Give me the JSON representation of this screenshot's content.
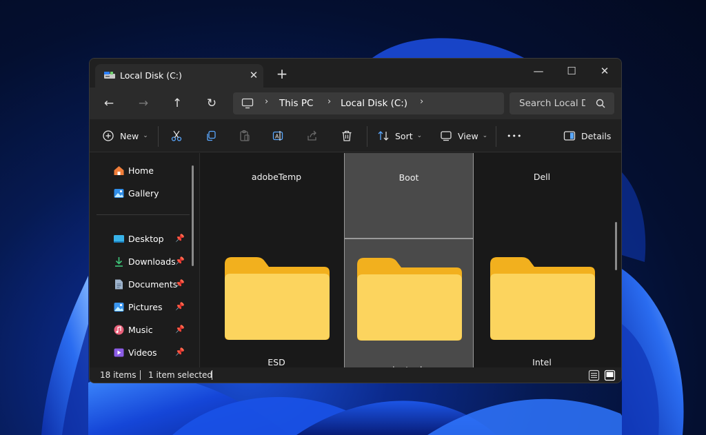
{
  "window": {
    "tab_title": "Local Disk (C:)",
    "tab_close": "✕",
    "new_tab": "+",
    "minimize": "—",
    "maximize": "☐",
    "close": "✕"
  },
  "nav": {
    "back": "←",
    "forward": "→",
    "up": "↑",
    "refresh": "↻",
    "breadcrumb": [
      "This PC",
      "Local Disk (C:)"
    ],
    "separator": "›",
    "search_placeholder": "Search Local Disk (C:)"
  },
  "toolbar": {
    "new_label": "New",
    "sort_label": "Sort",
    "view_label": "View",
    "more_label": "•••",
    "details_label": "Details",
    "caret": "⌄"
  },
  "sidebar": {
    "top": [
      {
        "label": "Home",
        "icon": "home-icon"
      },
      {
        "label": "Gallery",
        "icon": "gallery-icon"
      }
    ],
    "quick_access": [
      {
        "label": "Desktop",
        "icon": "desktop-icon",
        "pinned": true
      },
      {
        "label": "Downloads",
        "icon": "downloads-icon",
        "pinned": true
      },
      {
        "label": "Documents",
        "icon": "documents-icon",
        "pinned": true
      },
      {
        "label": "Pictures",
        "icon": "pictures-icon",
        "pinned": true
      },
      {
        "label": "Music",
        "icon": "music-icon",
        "pinned": true
      },
      {
        "label": "Videos",
        "icon": "videos-icon",
        "pinned": true
      }
    ],
    "pin_glyph": "📌"
  },
  "folders": [
    {
      "name": "adobeTemp",
      "selected": false
    },
    {
      "name": "Boot",
      "selected": true
    },
    {
      "name": "Dell",
      "selected": false
    },
    {
      "name": "ESD",
      "selected": false,
      "dimmed": true
    },
    {
      "name": "inetpub",
      "selected": false
    },
    {
      "name": "Intel",
      "selected": false
    }
  ],
  "status": {
    "item_count": "18 items",
    "selection": "1 item selected"
  },
  "colors": {
    "folder_back": "#f2b01e",
    "folder_front": "#fcd45e",
    "window_bg": "#1c1c1c",
    "selection_bg": "#4a4a4a"
  }
}
